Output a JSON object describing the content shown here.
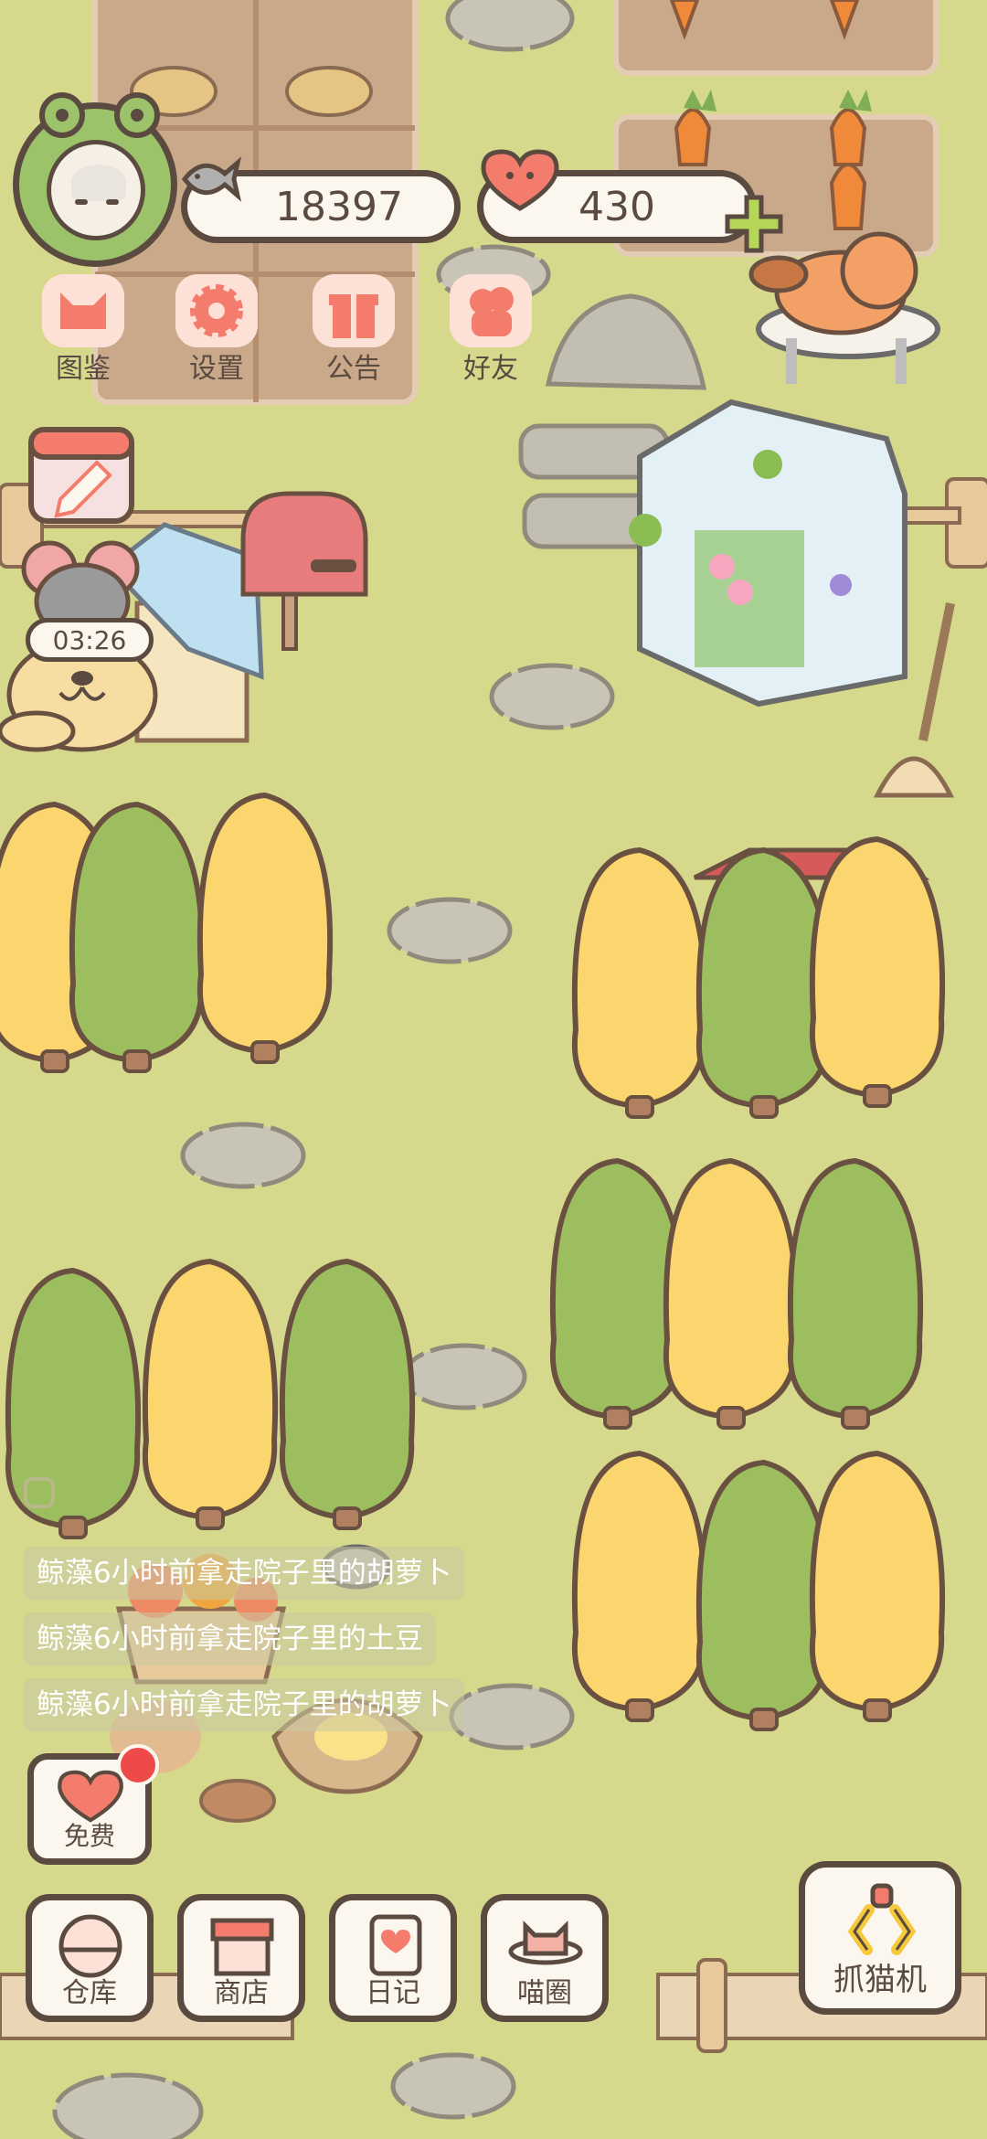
{
  "colors": {
    "grass": "#d6d98c",
    "outline": "#5a4a40",
    "tree_yellow": "#fbd66f",
    "tree_green": "#9dbe5e",
    "stone": "#c9c5b6",
    "accent_pink": "#f47c6c",
    "notice_red": "#ef4a4a"
  },
  "hud": {
    "fish_count": "18397",
    "heart_count": "430",
    "icons": [
      "frog-avatar-icon",
      "fish-icon",
      "heart-icon",
      "plus-icon"
    ]
  },
  "top_menu": [
    {
      "label": "图鉴",
      "icon": "cat-book-icon"
    },
    {
      "label": "设置",
      "icon": "gear-icon"
    },
    {
      "label": "公告",
      "icon": "gift-icon"
    },
    {
      "label": "好友",
      "icon": "friends-icon"
    }
  ],
  "timer": "03:26",
  "activity_feed": [
    "鲸藻6小时前拿走院子里的胡萝卜",
    "鲸藻6小时前拿走院子里的土豆",
    "鲸藻6小时前拿走院子里的胡萝卜"
  ],
  "free_button": {
    "label": "免费",
    "icon": "heart-icon"
  },
  "bottom_nav": [
    {
      "label": "仓库",
      "icon": "warehouse-icon"
    },
    {
      "label": "商店",
      "icon": "shop-icon"
    },
    {
      "label": "日记",
      "icon": "diary-icon"
    },
    {
      "label": "喵圈",
      "icon": "cat-planet-icon"
    }
  ],
  "claw_machine": {
    "label": "抓猫机",
    "icon": "claw-icon"
  }
}
